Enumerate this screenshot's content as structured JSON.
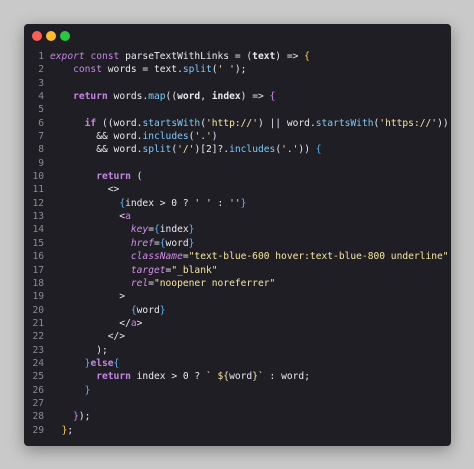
{
  "window": {
    "traffic_lights": {
      "close_color": "#ff5f57",
      "minimize_color": "#febc2e",
      "zoom_color": "#28c840"
    }
  },
  "editor": {
    "language": "javascript-jsx",
    "lines": [
      {
        "n": "1",
        "tokens": [
          [
            "kw-it",
            "export "
          ],
          [
            "kw",
            "const "
          ],
          [
            "var",
            "parseTextWithLinks "
          ],
          [
            "op",
            "= ("
          ],
          [
            "var t-bold",
            "text"
          ],
          [
            "op",
            ") => "
          ],
          [
            "br1",
            "{"
          ]
        ]
      },
      {
        "n": "2",
        "tokens": [
          [
            "op",
            "    "
          ],
          [
            "kw",
            "const "
          ],
          [
            "var",
            "words "
          ],
          [
            "op",
            "= "
          ],
          [
            "var",
            "text"
          ],
          [
            "op",
            "."
          ],
          [
            "fn",
            "split"
          ],
          [
            "op",
            "("
          ],
          [
            "str",
            "' '"
          ],
          [
            "op",
            ");"
          ]
        ]
      },
      {
        "n": "3",
        "tokens": []
      },
      {
        "n": "4",
        "tokens": [
          [
            "op",
            "    "
          ],
          [
            "kw t-bold",
            "return "
          ],
          [
            "var",
            "words"
          ],
          [
            "op",
            "."
          ],
          [
            "fn",
            "map"
          ],
          [
            "op",
            "(("
          ],
          [
            "var t-bold",
            "word"
          ],
          [
            "op",
            ", "
          ],
          [
            "var t-bold",
            "index"
          ],
          [
            "op",
            ") => "
          ],
          [
            "br2",
            "{"
          ]
        ]
      },
      {
        "n": "5",
        "tokens": []
      },
      {
        "n": "6",
        "tokens": [
          [
            "op",
            "      "
          ],
          [
            "kw t-bold",
            "if "
          ],
          [
            "op",
            "(("
          ],
          [
            "var",
            "word"
          ],
          [
            "op",
            "."
          ],
          [
            "fn",
            "startsWith"
          ],
          [
            "op",
            "("
          ],
          [
            "str",
            "'http://'"
          ],
          [
            "op",
            ") || "
          ],
          [
            "var",
            "word"
          ],
          [
            "op",
            "."
          ],
          [
            "fn",
            "startsWith"
          ],
          [
            "op",
            "("
          ],
          [
            "str",
            "'https://'"
          ],
          [
            "op",
            "))"
          ]
        ]
      },
      {
        "n": "7",
        "tokens": [
          [
            "op",
            "        && "
          ],
          [
            "var",
            "word"
          ],
          [
            "op",
            "."
          ],
          [
            "fn",
            "includes"
          ],
          [
            "op",
            "("
          ],
          [
            "str",
            "'.'"
          ],
          [
            "op",
            ")"
          ]
        ]
      },
      {
        "n": "8",
        "tokens": [
          [
            "op",
            "        && "
          ],
          [
            "var",
            "word"
          ],
          [
            "op",
            "."
          ],
          [
            "fn",
            "split"
          ],
          [
            "op",
            "("
          ],
          [
            "str",
            "'/'"
          ],
          [
            "op",
            ")[2]?."
          ],
          [
            "fn",
            "includes"
          ],
          [
            "op",
            "("
          ],
          [
            "str",
            "'.'"
          ],
          [
            "op",
            ")) "
          ],
          [
            "br3",
            "{"
          ]
        ]
      },
      {
        "n": "9",
        "tokens": []
      },
      {
        "n": "10",
        "tokens": [
          [
            "op",
            "        "
          ],
          [
            "kw t-bold",
            "return "
          ],
          [
            "op",
            "("
          ]
        ]
      },
      {
        "n": "11",
        "tokens": [
          [
            "op",
            "          <>"
          ]
        ]
      },
      {
        "n": "12",
        "tokens": [
          [
            "op",
            "            "
          ],
          [
            "br3",
            "{"
          ],
          [
            "var",
            "index "
          ],
          [
            "op",
            "> 0 ? "
          ],
          [
            "str",
            "' '"
          ],
          [
            "op",
            " : "
          ],
          [
            "str",
            "''"
          ],
          [
            "br3",
            "}"
          ]
        ]
      },
      {
        "n": "13",
        "tokens": [
          [
            "op",
            "            <"
          ],
          [
            "kw",
            "a"
          ]
        ]
      },
      {
        "n": "14",
        "tokens": [
          [
            "op",
            "              "
          ],
          [
            "attr",
            "key"
          ],
          [
            "op",
            "="
          ],
          [
            "br3",
            "{"
          ],
          [
            "var",
            "index"
          ],
          [
            "br3",
            "}"
          ]
        ]
      },
      {
        "n": "15",
        "tokens": [
          [
            "op",
            "              "
          ],
          [
            "attr",
            "href"
          ],
          [
            "op",
            "="
          ],
          [
            "br3",
            "{"
          ],
          [
            "var",
            "word"
          ],
          [
            "br3",
            "}"
          ]
        ]
      },
      {
        "n": "16",
        "tokens": [
          [
            "op",
            "              "
          ],
          [
            "attr",
            "className"
          ],
          [
            "op",
            "="
          ],
          [
            "str",
            "\"text-blue-600 hover:text-blue-800 underline\""
          ]
        ]
      },
      {
        "n": "17",
        "tokens": [
          [
            "op",
            "              "
          ],
          [
            "attr",
            "target"
          ],
          [
            "op",
            "="
          ],
          [
            "str",
            "\"_blank\""
          ]
        ]
      },
      {
        "n": "18",
        "tokens": [
          [
            "op",
            "              "
          ],
          [
            "attr",
            "rel"
          ],
          [
            "op",
            "="
          ],
          [
            "str",
            "\"noopener noreferrer\""
          ]
        ]
      },
      {
        "n": "19",
        "tokens": [
          [
            "op",
            "            >"
          ]
        ]
      },
      {
        "n": "20",
        "tokens": [
          [
            "op",
            "              "
          ],
          [
            "br3",
            "{"
          ],
          [
            "var",
            "word"
          ],
          [
            "br3",
            "}"
          ]
        ]
      },
      {
        "n": "21",
        "tokens": [
          [
            "op",
            "            </"
          ],
          [
            "kw",
            "a"
          ],
          [
            "op",
            ">"
          ]
        ]
      },
      {
        "n": "22",
        "tokens": [
          [
            "op",
            "          </>"
          ]
        ]
      },
      {
        "n": "23",
        "tokens": [
          [
            "op",
            "        );"
          ]
        ]
      },
      {
        "n": "24",
        "tokens": [
          [
            "op",
            "      "
          ],
          [
            "br3",
            "}"
          ],
          [
            "kw t-bold",
            "else"
          ],
          [
            "br3",
            "{"
          ]
        ]
      },
      {
        "n": "25",
        "tokens": [
          [
            "op",
            "        "
          ],
          [
            "kw t-bold",
            "return "
          ],
          [
            "var",
            "index "
          ],
          [
            "op",
            "> 0 ? "
          ],
          [
            "str",
            "` ${"
          ],
          [
            "var",
            "word"
          ],
          [
            "str",
            "}`"
          ],
          [
            "op",
            " : "
          ],
          [
            "var",
            "word"
          ],
          [
            "op",
            ";"
          ]
        ]
      },
      {
        "n": "26",
        "tokens": [
          [
            "op",
            "      "
          ],
          [
            "br3",
            "}"
          ]
        ]
      },
      {
        "n": "27",
        "tokens": []
      },
      {
        "n": "28",
        "tokens": [
          [
            "op",
            "    "
          ],
          [
            "br2",
            "}"
          ],
          [
            "op",
            ");"
          ]
        ]
      },
      {
        "n": "29",
        "tokens": [
          [
            "op",
            "  "
          ],
          [
            "br1",
            "}"
          ],
          [
            "op",
            ";"
          ]
        ]
      }
    ]
  }
}
